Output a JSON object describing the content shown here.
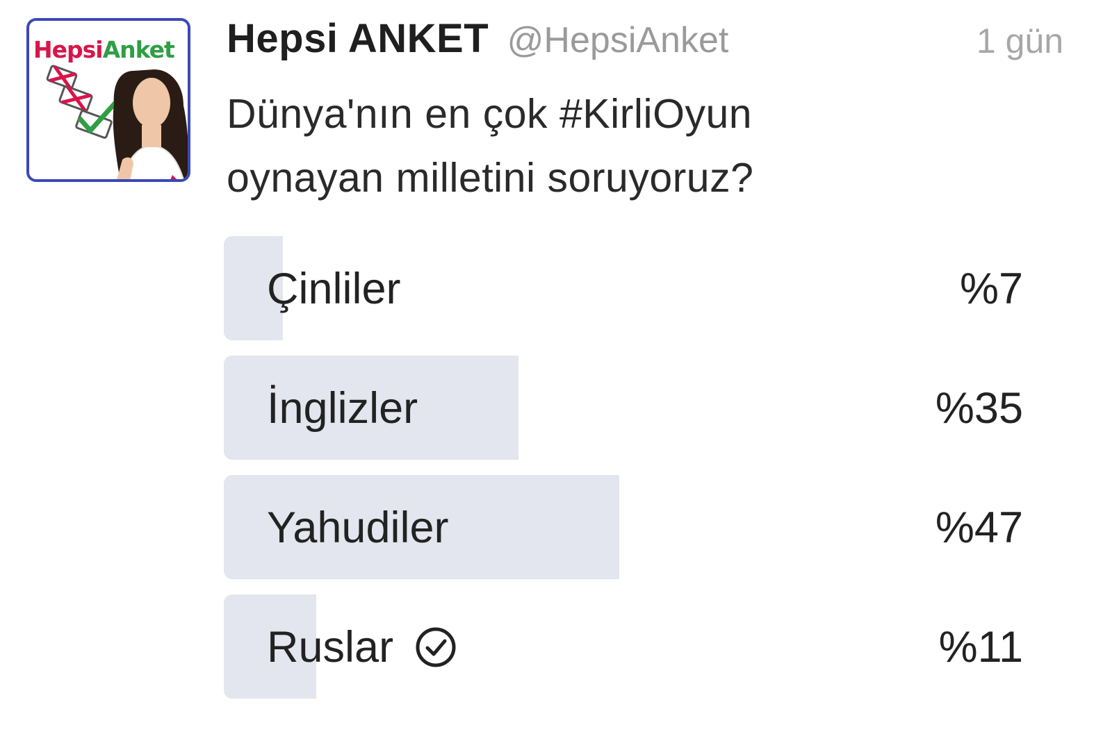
{
  "tweet": {
    "display_name": "Hepsi ANKET",
    "handle": "@HepsiAnket",
    "time": "1 gün",
    "text_line1": "Dünya'nın en çok #KirliOyun",
    "text_line2": "oynayan milletini soruyoruz?",
    "avatar": {
      "logo_part1": "Hepsi",
      "logo_part2": "Anket",
      "border_color": "#3a48b8"
    }
  },
  "poll": {
    "options": [
      {
        "label": "Çinliler",
        "percent_text": "%7",
        "percent": 7,
        "selected": false
      },
      {
        "label": "İnglizler",
        "percent_text": "%35",
        "percent": 35,
        "selected": false
      },
      {
        "label": "Yahudiler",
        "percent_text": "%47",
        "percent": 47,
        "selected": false
      },
      {
        "label": "Ruslar",
        "percent_text": "%11",
        "percent": 11,
        "selected": true
      }
    ],
    "bar_color": "#e3e6ee",
    "selected_icon": "check-circle-icon"
  }
}
